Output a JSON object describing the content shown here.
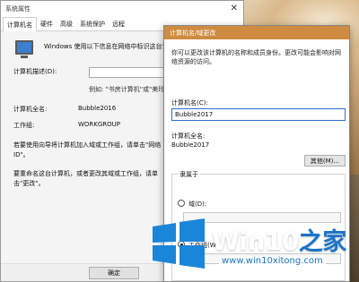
{
  "system_window": {
    "title": "系统属性",
    "tabs": [
      "计算机名",
      "硬件",
      "高级",
      "系统保护",
      "远程"
    ],
    "active_tab": "计算机名",
    "description": "Windows 使用以下信息在网络中标识这台计算机",
    "computer_desc_label": "计算机描述(D):",
    "computer_desc_value": "",
    "hint": "例如: \"书房计算机\"或\"美玲的",
    "full_name_label": "计算机全名:",
    "full_name_value": "Bubble2016",
    "workgroup_label": "工作组:",
    "workgroup_value": "WORKGROUP",
    "wizard_text": "若要使用向导将计算机加入域或工作组，请单击\"网络 ID\"。",
    "rename_text": "要重命名这台计算机，或者更改其域或工作组，请单击\"更改\"。",
    "ok_label": "确定"
  },
  "name_dialog": {
    "title": "计算机名/域更改",
    "description": "你可以更改该计算机的名称和成员身份。更改可能会影响对网络资源的访问。",
    "computer_name_label": "计算机名(C):",
    "computer_name_value": "Bubble2017",
    "full_name_label": "计算机全名:",
    "full_name_value": "Bubble2017",
    "other_label": "其他(M)...",
    "member_of_label": "隶属于",
    "domain_label": "域(D):",
    "workgroup_label": "工作组(W):",
    "selected": "workgroup"
  },
  "watermark": {
    "brand_prefix": "Win10",
    "brand_suffix": "之家",
    "url": "www.win10xitong.com"
  },
  "colors": {
    "dialog_titlebar": "#cf8b3f",
    "accent_blue": "#1a74c9"
  }
}
